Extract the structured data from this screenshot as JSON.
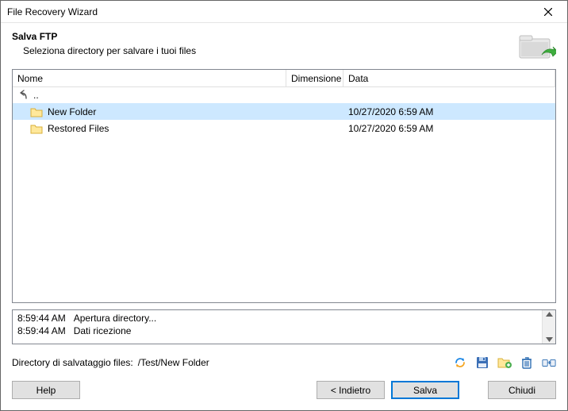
{
  "window": {
    "title": "File Recovery Wizard"
  },
  "header": {
    "title": "Salva FTP",
    "subtitle": "Seleziona directory per salvare i tuoi files"
  },
  "columns": {
    "name": "Nome",
    "size": "Dimensione",
    "date": "Data"
  },
  "up_label": "..",
  "rows": [
    {
      "name": "New Folder",
      "size": "",
      "date": "10/27/2020 6:59 AM",
      "selected": true
    },
    {
      "name": "Restored Files",
      "size": "",
      "date": "10/27/2020 6:59 AM",
      "selected": false
    }
  ],
  "log": [
    {
      "time": "8:59:44 AM",
      "msg": "Apertura directory..."
    },
    {
      "time": "8:59:44 AM",
      "msg": "Dati ricezione"
    }
  ],
  "save_dir": {
    "label": "Directory di salvataggio files:",
    "path": "/Test/New Folder"
  },
  "buttons": {
    "help": "Help",
    "back": "< Indietro",
    "save": "Salva",
    "close": "Chiudi"
  }
}
